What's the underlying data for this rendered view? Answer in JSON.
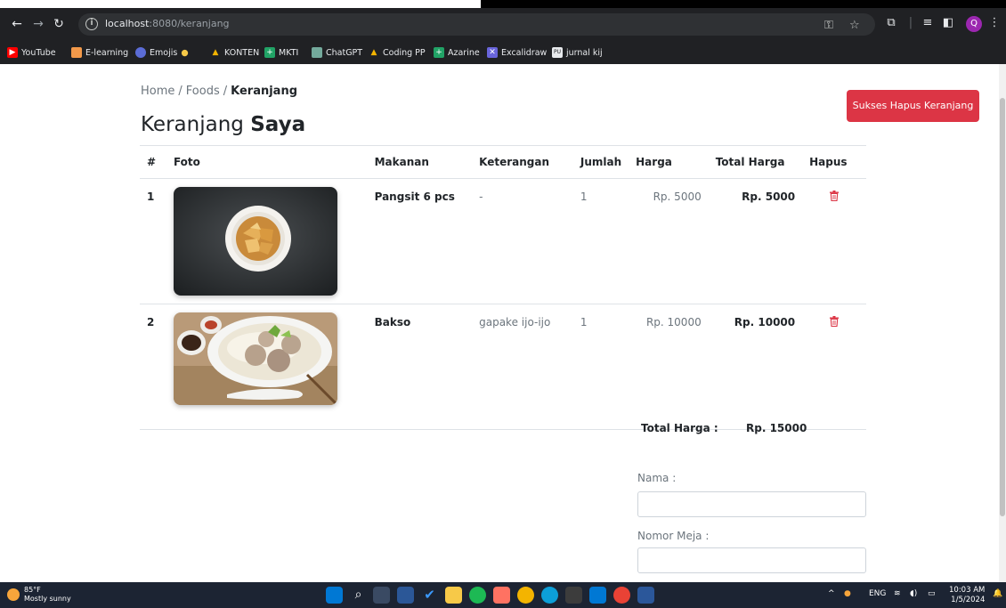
{
  "browser": {
    "url_host": "localhost",
    "url_path": ":8080/keranjang",
    "bookmarks": [
      "YouTube",
      "E-learning",
      "Emojis",
      "KONTEN",
      "MKTI",
      "ChatGPT",
      "Coding PP",
      "Azarine",
      "Excalidraw",
      "jurnal kij"
    ]
  },
  "page": {
    "breadcrumb": {
      "home": "Home",
      "sep": "/",
      "foods": "Foods",
      "current": "Keranjang"
    },
    "title_light": "Keranjang",
    "title_bold": "Saya",
    "toast": "Sukses Hapus Keranjang",
    "table": {
      "headers": [
        "#",
        "Foto",
        "Makanan",
        "Keterangan",
        "Jumlah",
        "Harga",
        "Total Harga",
        "Hapus"
      ],
      "rows": [
        {
          "no": "1",
          "makanan": "Pangsit 6 pcs",
          "keterangan": "-",
          "jumlah": "1",
          "harga": "Rp. 5000",
          "total": "Rp. 5000"
        },
        {
          "no": "2",
          "makanan": "Bakso",
          "keterangan": "gapake ijo-ijo",
          "jumlah": "1",
          "harga": "Rp. 10000",
          "total": "Rp. 10000"
        }
      ]
    },
    "summary": {
      "label": "Total Harga :",
      "value": "Rp. 15000"
    },
    "form": {
      "nama_label": "Nama :",
      "meja_label": "Nomor Meja :"
    }
  },
  "taskbar": {
    "temp": "85°F",
    "weather": "Mostly sunny",
    "lang": "ENG",
    "time": "10:03 AM",
    "date": "1/5/2024"
  }
}
